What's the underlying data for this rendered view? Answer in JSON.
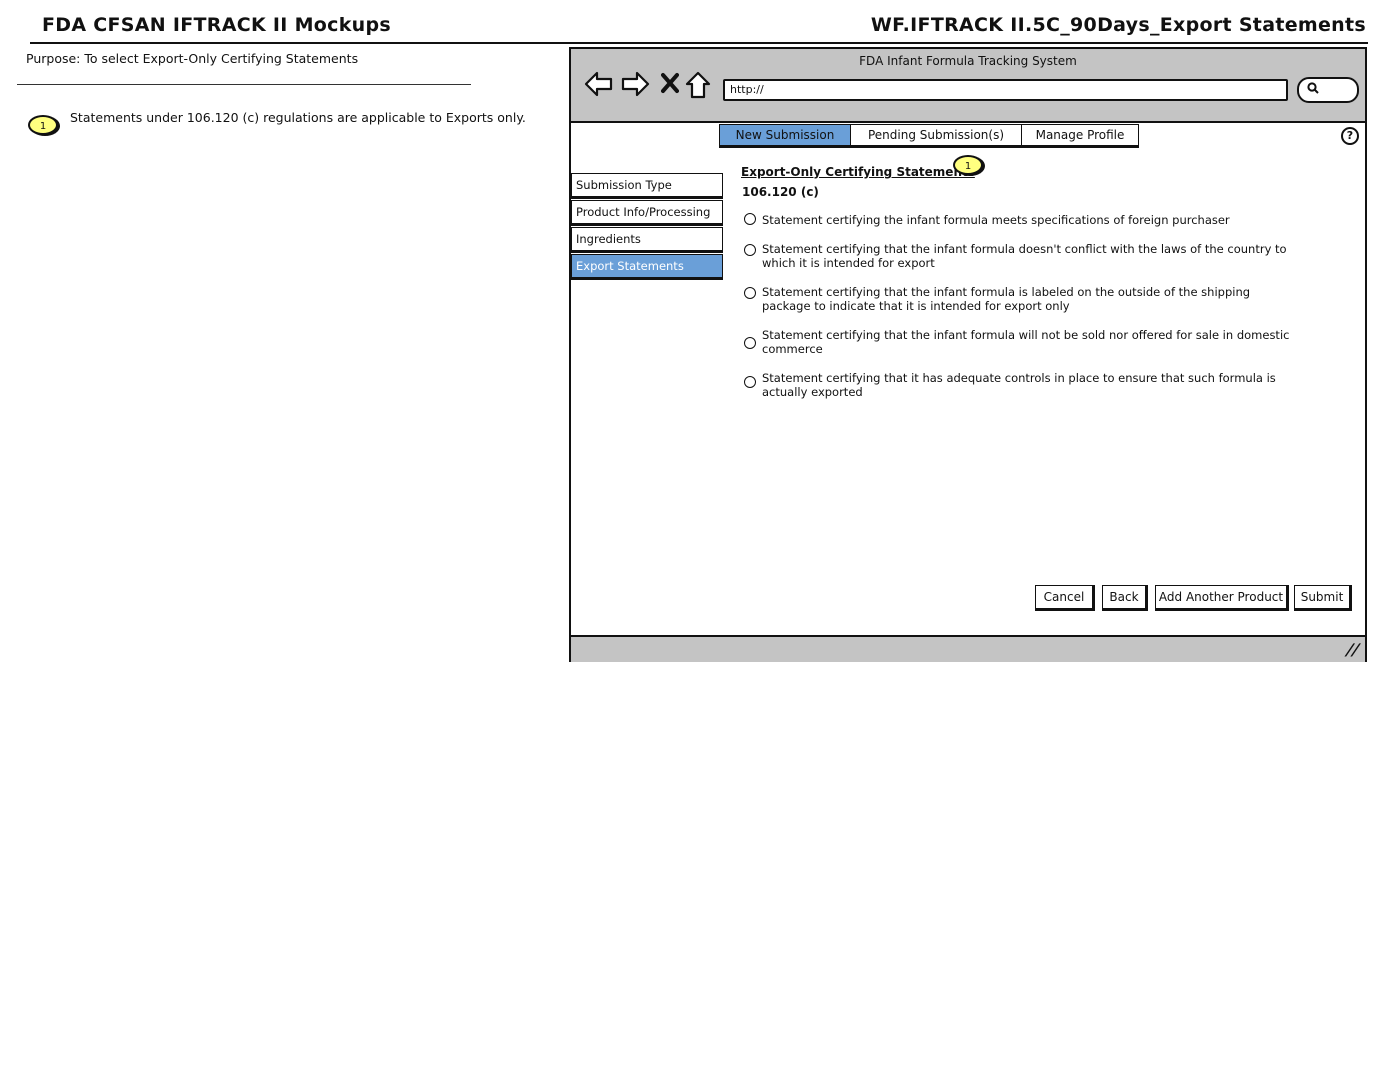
{
  "header": {
    "title": "FDA CFSAN IFTRACK II Mockups",
    "screen_id": "WF.IFTRACK II.5C_90Days_Export Statements"
  },
  "purpose": "Purpose: To select Export-Only Certifying Statements",
  "notes": [
    {
      "badge": "1",
      "text": "Statements under 106.120 (c) regulations are applicable to Exports only."
    }
  ],
  "browser": {
    "title": "FDA Infant Formula Tracking System",
    "url": "http://",
    "nav_icons": [
      "back-arrow-icon",
      "forward-arrow-icon",
      "stop-icon",
      "home-icon"
    ]
  },
  "tabs": [
    {
      "label": "New Submission",
      "active": true
    },
    {
      "label": "Pending Submission(s)",
      "active": false
    },
    {
      "label": "Manage Profile",
      "active": false
    }
  ],
  "help_glyph": "?",
  "sidenav": [
    {
      "label": "Submission Type",
      "active": false
    },
    {
      "label": "Product Info/Processing",
      "active": false
    },
    {
      "label": "Ingredients",
      "active": false
    },
    {
      "label": "Export Statements",
      "active": true
    }
  ],
  "form": {
    "section_title": "Export-Only Certifying Statements",
    "section_badge": "1",
    "regulation": "106.120 (c)",
    "options": [
      "Statement certifying the infant formula meets specifications of foreign purchaser",
      "Statement certifying that the infant formula doesn't conflict with the laws of the country to which it is intended for export",
      "Statement certifying that the infant formula is labeled on the outside of the shipping package to indicate that it is intended for export only",
      "Statement certifying that the infant formula will not be sold nor offered for sale in domestic commerce",
      "Statement certifying that it has adequate controls in place to ensure that such formula is actually exported"
    ]
  },
  "buttons": {
    "cancel": "Cancel",
    "back": "Back",
    "add_another": "Add Another Product",
    "submit": "Submit"
  },
  "colors": {
    "active_tab": "#6a9fd8",
    "badge": "#ffff80",
    "chrome": "#c4c4c4"
  }
}
